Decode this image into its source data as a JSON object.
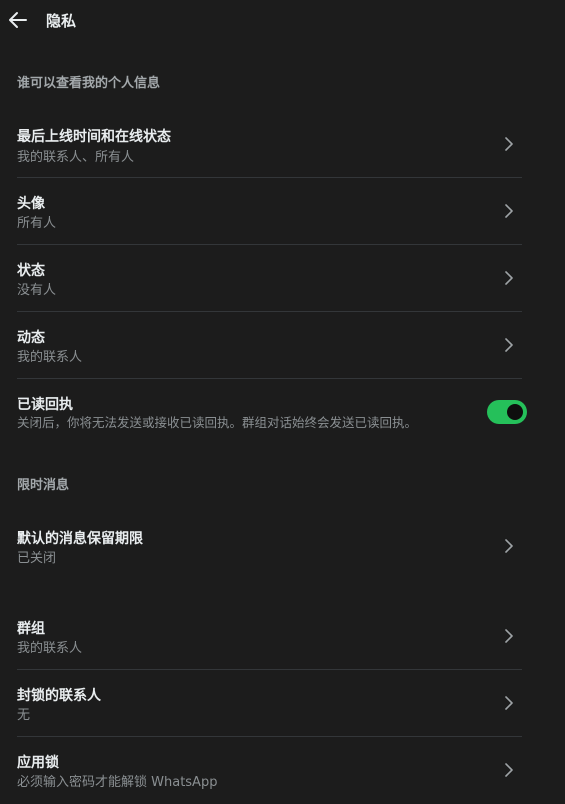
{
  "header": {
    "title": "隐私"
  },
  "sections": {
    "personal_info_title": "谁可以查看我的个人信息",
    "disappearing_title": "限时消息"
  },
  "rows": {
    "last_seen": {
      "label": "最后上线时间和在线状态",
      "value": "我的联系人、所有人"
    },
    "profile_photo": {
      "label": "头像",
      "value": "所有人"
    },
    "about": {
      "label": "状态",
      "value": "没有人"
    },
    "status": {
      "label": "动态",
      "value": "我的联系人"
    },
    "read_receipts": {
      "label": "已读回执",
      "value": "关闭后，你将无法发送或接收已读回执。群组对话始终会发送已读回执。",
      "enabled": true
    },
    "default_timer": {
      "label": "默认的消息保留期限",
      "value": "已关闭"
    },
    "groups": {
      "label": "群组",
      "value": "我的联系人"
    },
    "blocked": {
      "label": "封锁的联系人",
      "value": "无"
    },
    "app_lock": {
      "label": "应用锁",
      "value": "必须输入密码才能解锁 WhatsApp"
    }
  },
  "colors": {
    "background": "#1c1c1c",
    "toggle_on": "#25c05a",
    "text_primary": "#e9edef",
    "text_secondary": "#8a8f92"
  },
  "icons": {
    "back": "arrow-left-icon",
    "chevron": "chevron-right-icon"
  }
}
